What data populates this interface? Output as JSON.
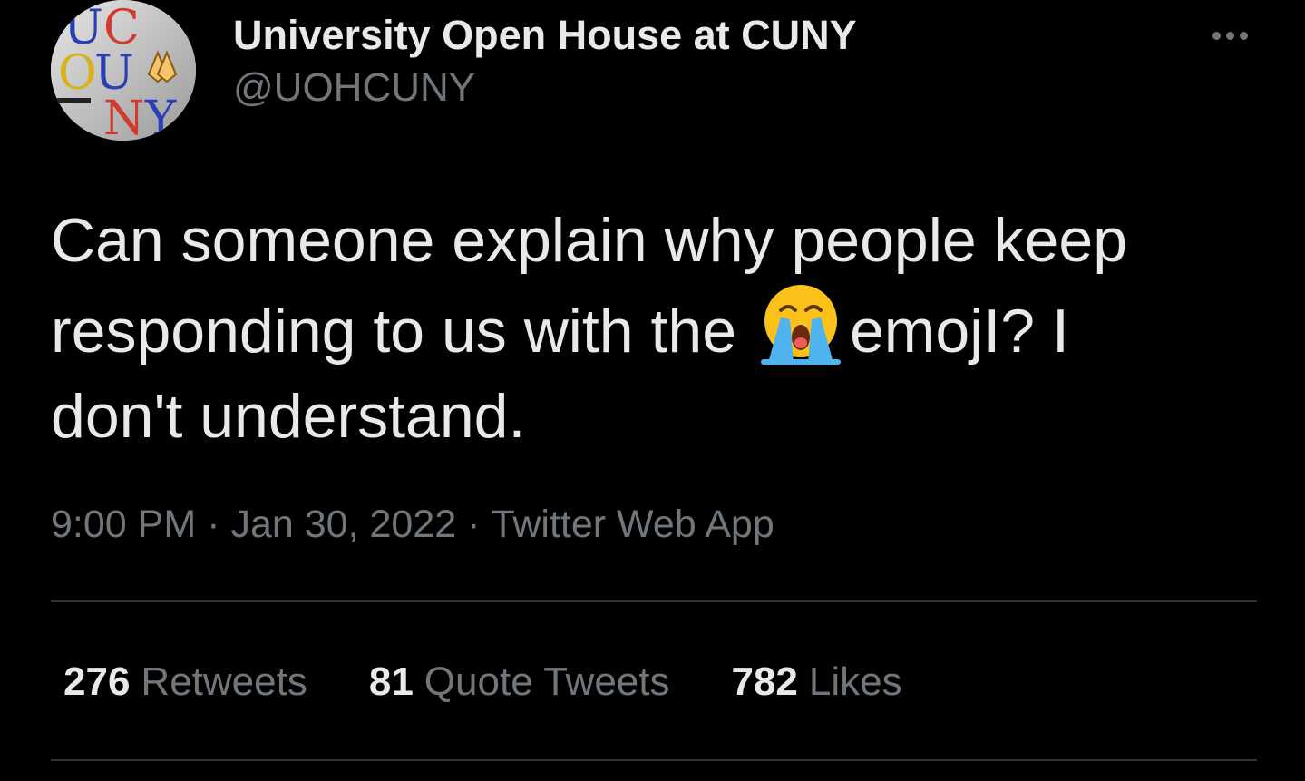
{
  "tweet": {
    "author": {
      "display_name": "University Open House at CUNY",
      "handle": "@UOHCUNY",
      "avatar_icon": "avatar-icon",
      "avatar_logo_letters": [
        "U",
        "C",
        "O",
        "U",
        "N",
        "Y"
      ]
    },
    "more_icon": "more-horizontal-icon",
    "text": {
      "line1": "Can someone explain why people keep",
      "line2_before_emoji": "responding to us with the",
      "emoji_icon": "loudly-crying-face-icon",
      "line2_after_emoji": "emojI? I",
      "line3": "don't understand."
    },
    "meta": {
      "time": "9:00 PM",
      "separator": "·",
      "date": "Jan 30, 2022",
      "source": "Twitter Web App"
    },
    "stats": {
      "retweets": {
        "count": "276",
        "label": "Retweets"
      },
      "quote_tweets": {
        "count": "81",
        "label": "Quote Tweets"
      },
      "likes": {
        "count": "782",
        "label": "Likes"
      }
    }
  },
  "colors": {
    "background": "#000000",
    "primary_text": "#e7e9ea",
    "secondary_text": "#71767b",
    "divider": "#2f3336"
  }
}
